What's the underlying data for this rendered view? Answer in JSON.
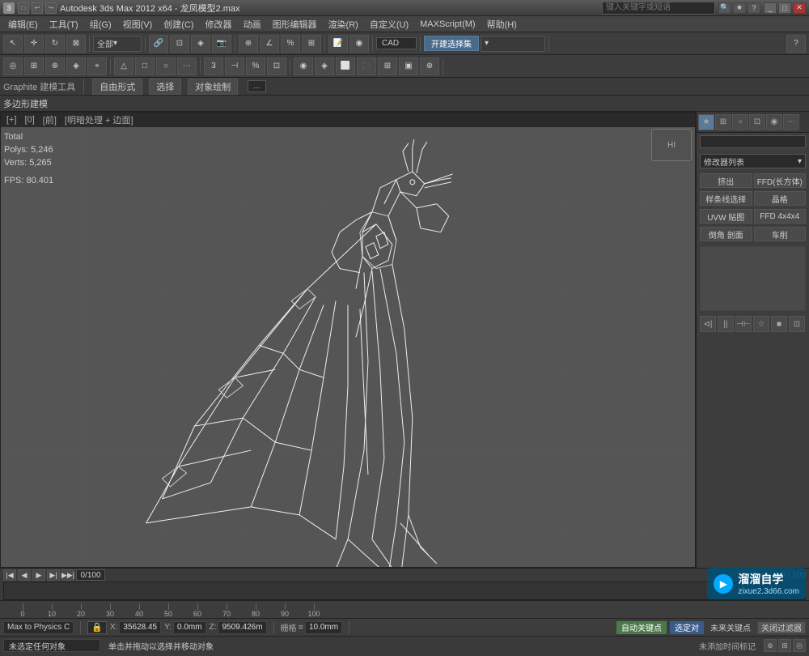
{
  "titlebar": {
    "title": "Autodesk 3ds Max 2012 x64 - 龙凤模型2.max",
    "search_placeholder": "键入关键字或短语",
    "controls": [
      "_",
      "□",
      "✕"
    ]
  },
  "menubar": {
    "items": [
      "编辑(E)",
      "工具(T)",
      "组(G)",
      "视图(V)",
      "创建(C)",
      "修改器",
      "动画",
      "图形编辑器",
      "渲染(R)",
      "自定义(U)",
      "MAXScript(M)",
      "帮助(H)"
    ]
  },
  "toolbar1": {
    "all_label": "全部",
    "dropdown_all": "全部"
  },
  "graphite_bar": {
    "section_label": "Graphite 建模工具",
    "btn1": "自由形式",
    "btn2": "选择",
    "btn3": "对象绘制",
    "mode_indicator": "..."
  },
  "poly_subobject": {
    "label": "多边形建模"
  },
  "viewport": {
    "header": "+ 0 前 □ 明暗处理 + 边面",
    "header_parts": [
      "[+]",
      "[0]",
      "[前]",
      "[□ 明暗处理 + 边面]"
    ]
  },
  "stats": {
    "total_label": "Total",
    "polys_label": "Polys:",
    "polys_value": "5,246",
    "verts_label": "Verts:",
    "verts_value": "5,265",
    "fps_label": "FPS:",
    "fps_value": "80.401"
  },
  "nav_cube": {
    "label": "HI"
  },
  "right_panel": {
    "icons": [
      "★",
      "⊞",
      "○",
      "⊡",
      "⋯"
    ],
    "modifier_label": "修改器列表",
    "btn_extrude": "挤出",
    "btn_ffd_rect": "FFD(长方体)",
    "btn_sample": "样条线选择",
    "btn_crystal": "晶格",
    "btn_uvw": "UVW 贴图",
    "btn_ffd4": "FFD 4x4x4",
    "btn_chamfer": "倒角 剖面",
    "btn_lathe": "车削",
    "icon_row": [
      "⊲|",
      "||",
      "⊣⊢",
      "☆",
      "■",
      "⊡"
    ]
  },
  "timeline": {
    "frame_start": "0",
    "frame_end": "100",
    "current_frame": "0"
  },
  "timescale": {
    "ticks": [
      "0",
      "10",
      "20",
      "30",
      "40",
      "50",
      "60",
      "70",
      "80",
      "90",
      "100"
    ]
  },
  "status_bar": {
    "x_label": "X:",
    "x_value": "35628.45",
    "y_label": "Y:",
    "y_value": "0.0mm",
    "z_label": "Z:",
    "z_value": "9509.426m",
    "grid_label": "栅格",
    "grid_value": "10.0mm",
    "auto_key": "自动关键点",
    "select_override": "选定对",
    "filter_btn": "关闭过滤器",
    "key_label": "未来关键点"
  },
  "info_bar": {
    "status1": "未选定任何对象",
    "status2": "单击并拖动以选择并移动对象",
    "add_tag": "未添加时间标记"
  },
  "watermark": {
    "icon": "▶",
    "main": "溜溜自学",
    "sub": "zixue2.3d66.com"
  },
  "bottom_left": {
    "label": "Max to Physics C"
  }
}
